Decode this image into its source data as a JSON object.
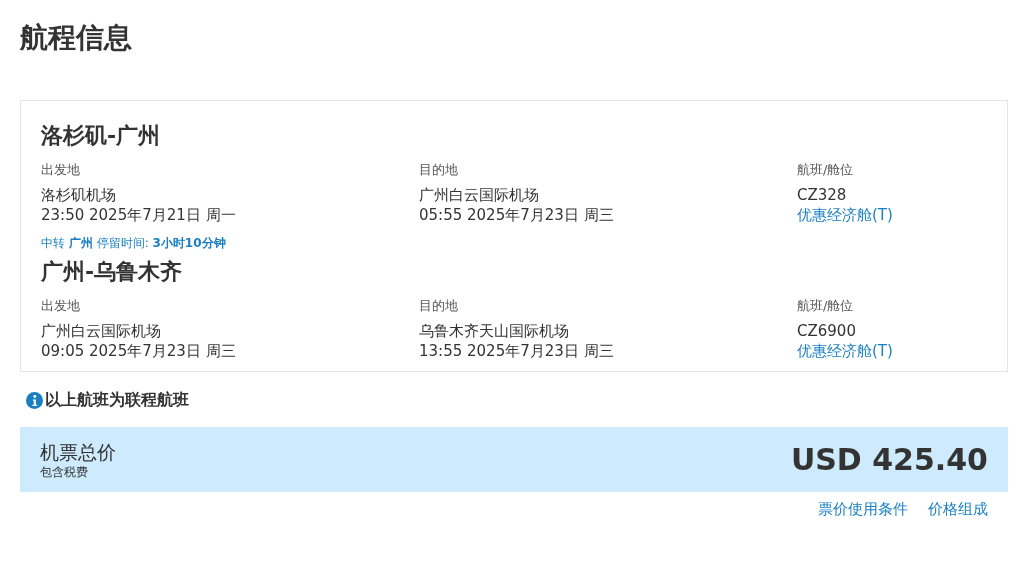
{
  "page_title": "航程信息",
  "segments": [
    {
      "route": "洛杉矶-广州",
      "departure": {
        "label": "出发地",
        "airport": "洛杉矶机场",
        "time": "23:50 2025年7月21日 周一"
      },
      "arrival": {
        "label": "目的地",
        "airport": "广州白云国际机场",
        "time": "05:55 2025年7月23日 周三"
      },
      "flight": {
        "label": "航班/舱位",
        "number": "CZ328",
        "cabin": "优惠经济舱(T)"
      },
      "layover": "中转 **广州** 停留时间: **3小时10分钟**"
    },
    {
      "route": "广州-乌鲁木齐",
      "departure": {
        "label": "出发地",
        "airport": "广州白云国际机场",
        "time": "09:05 2025年7月23日 周三"
      },
      "arrival": {
        "label": "目的地",
        "airport": "乌鲁木齐天山国际机场",
        "time": "13:55 2025年7月23日 周三"
      },
      "flight": {
        "label": "航班/舱位",
        "number": "CZ6900",
        "cabin": "优惠经济舱(T)"
      }
    }
  ],
  "notice": "以上航班为联程航班",
  "total": {
    "label": "机票总价",
    "sublabel": "包含税费",
    "amount": "USD 425.40"
  },
  "links": [
    "票价使用条件",
    "价格组成"
  ]
}
